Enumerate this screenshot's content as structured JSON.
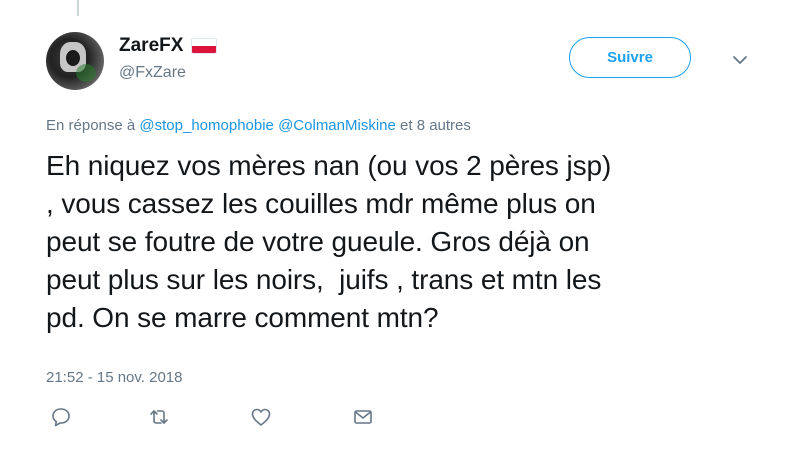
{
  "tweet": {
    "author": {
      "display_name": "ZareFX",
      "handle": "@FxZare"
    },
    "follow_label": "Suivre",
    "reply_context": {
      "prefix": "En réponse à",
      "mentions": [
        "@stop_homophobie",
        "@ColmanMiskine"
      ],
      "suffix": "et 8 autres"
    },
    "text": "Eh niquez vos mères nan (ou vos 2 pères jsp)\n, vous cassez les couilles mdr même plus on\npeut se foutre de votre gueule. Gros déjà on\npeut plus sur les noirs,  juifs , trans et mtn les\npd. On se marre comment mtn?",
    "timestamp": "21:52 - 15 nov. 2018",
    "actions": [
      "reply-icon",
      "retweet-icon",
      "like-icon",
      "direct-message-icon"
    ]
  },
  "colors": {
    "accent": "#1da1f2",
    "mention": "#1b95e0",
    "secondary_text": "#657786",
    "flag_red": "#dc143c"
  }
}
